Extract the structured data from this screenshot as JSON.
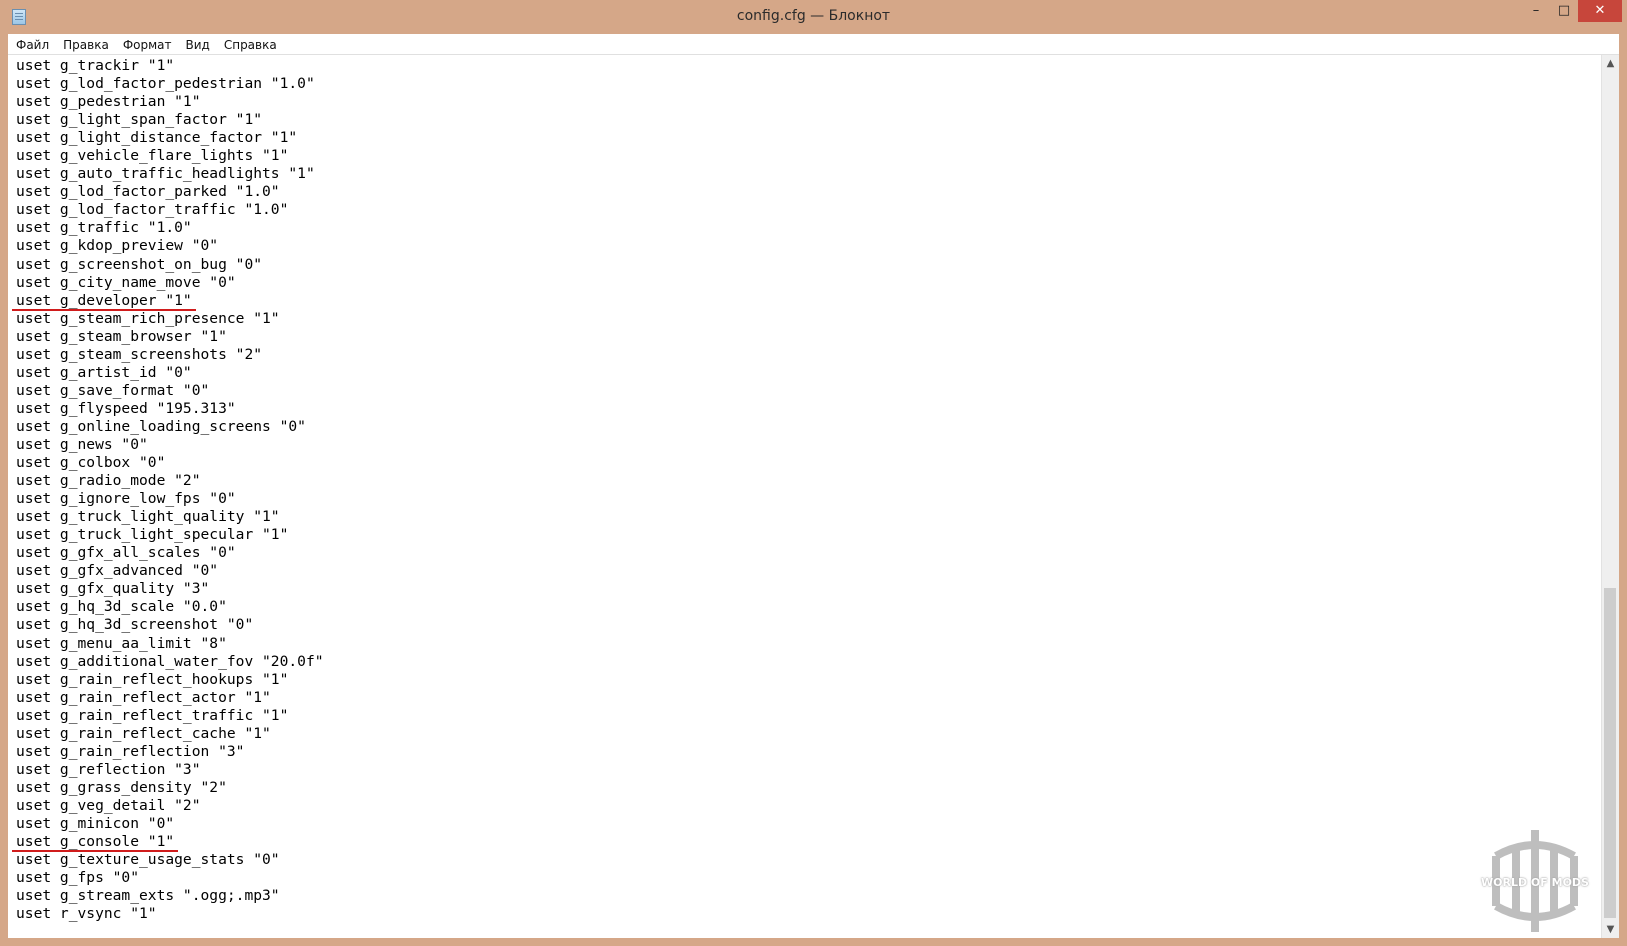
{
  "window": {
    "title": "config.cfg — Блокнот",
    "min_glyph": "–",
    "max_glyph": "□",
    "close_glyph": "✕"
  },
  "menu": {
    "items": [
      "Файл",
      "Правка",
      "Формат",
      "Вид",
      "Справка"
    ]
  },
  "editor": {
    "lines": [
      "uset g_trackir \"1\"",
      "uset g_lod_factor_pedestrian \"1.0\"",
      "uset g_pedestrian \"1\"",
      "uset g_light_span_factor \"1\"",
      "uset g_light_distance_factor \"1\"",
      "uset g_vehicle_flare_lights \"1\"",
      "uset g_auto_traffic_headlights \"1\"",
      "uset g_lod_factor_parked \"1.0\"",
      "uset g_lod_factor_traffic \"1.0\"",
      "uset g_traffic \"1.0\"",
      "uset g_kdop_preview \"0\"",
      "uset g_screenshot_on_bug \"0\"",
      "uset g_city_name_move \"0\"",
      "uset g_developer \"1\"",
      "uset g_steam_rich_presence \"1\"",
      "uset g_steam_browser \"1\"",
      "uset g_steam_screenshots \"2\"",
      "uset g_artist_id \"0\"",
      "uset g_save_format \"0\"",
      "uset g_flyspeed \"195.313\"",
      "uset g_online_loading_screens \"0\"",
      "uset g_news \"0\"",
      "uset g_colbox \"0\"",
      "uset g_radio_mode \"2\"",
      "uset g_ignore_low_fps \"0\"",
      "uset g_truck_light_quality \"1\"",
      "uset g_truck_light_specular \"1\"",
      "uset g_gfx_all_scales \"0\"",
      "uset g_gfx_advanced \"0\"",
      "uset g_gfx_quality \"3\"",
      "uset g_hq_3d_scale \"0.0\"",
      "uset g_hq_3d_screenshot \"0\"",
      "uset g_menu_aa_limit \"8\"",
      "uset g_additional_water_fov \"20.0f\"",
      "uset g_rain_reflect_hookups \"1\"",
      "uset g_rain_reflect_actor \"1\"",
      "uset g_rain_reflect_traffic \"1\"",
      "uset g_rain_reflect_cache \"1\"",
      "uset g_rain_reflection \"3\"",
      "uset g_reflection \"3\"",
      "uset g_grass_density \"2\"",
      "uset g_veg_detail \"2\"",
      "uset g_minicon \"0\"",
      "uset g_console \"1\"",
      "uset g_texture_usage_stats \"0\"",
      "uset g_fps \"0\"",
      "uset g_stream_exts \".ogg;.mp3\"",
      "uset r_vsync \"1\""
    ],
    "underlined_lines": [
      "uset g_developer \"1\"",
      "uset g_console \"1\""
    ],
    "underline_color": "#d01c1c"
  },
  "scrollbar": {
    "up_glyph": "▲",
    "down_glyph": "▼"
  },
  "watermark": {
    "text": "WORLD OF MODS"
  },
  "colors": {
    "frame": "#d5a788",
    "close_button": "#c7463b"
  }
}
